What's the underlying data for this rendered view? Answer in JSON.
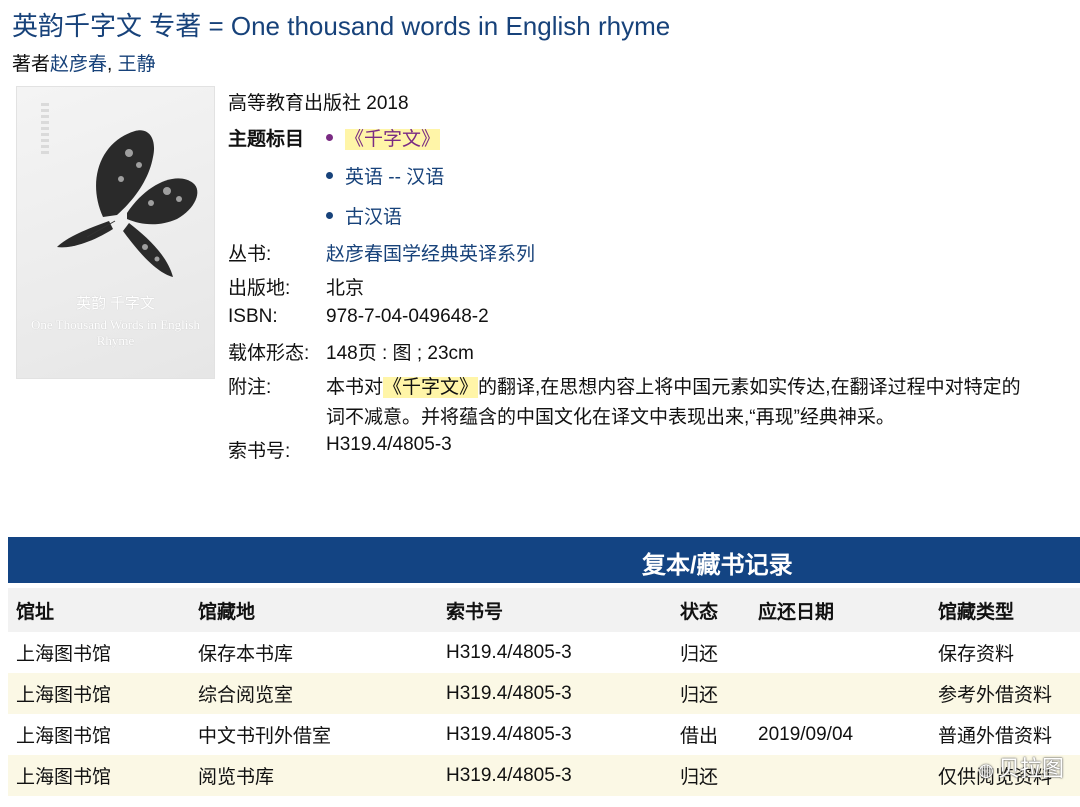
{
  "title": "英韵千字文 专著 = One thousand words in English rhyme",
  "authors_prefix": "著者",
  "authors": [
    "赵彦春",
    "王静"
  ],
  "authors_sep": ", ",
  "publisher_line": "高等教育出版社 2018",
  "subjects_label": "主题标目",
  "subjects": [
    "《千字文》",
    "英语 -- 汉语",
    "古汉语"
  ],
  "fields": [
    {
      "label": "丛书:",
      "value": "赵彦春国学经典英译系列"
    },
    {
      "label": "出版地:",
      "value": "北京"
    },
    {
      "label": "ISBN:",
      "value": "978-7-04-049648-2"
    },
    {
      "label": "载体形态:",
      "value": "148页 : 图 ; 23cm"
    }
  ],
  "note": {
    "label": "附注:",
    "line1_prefix": "本书对",
    "line1_highlight": "《千字文》",
    "line1_suffix": "的翻译,在思想内容上将中国元素如实传达,在翻译过程中对特定的",
    "line2": "词不减意。并将蕴含的中国文化在译文中表现出来,“再现”经典神采。"
  },
  "call_number": {
    "label": "索书号:",
    "value": "H319.4/4805-3"
  },
  "cover": {
    "title": "英韵 千字文",
    "subtitle": "One Thousand Words in English Rhyme"
  },
  "holdings": {
    "banner": "复本/藏书记录",
    "columns": [
      "馆址",
      "馆藏地",
      "索书号",
      "状态",
      "应还日期",
      "馆藏类型"
    ],
    "rows": [
      [
        "上海图书馆",
        "保存本书库",
        "H319.4/4805-3",
        "归还",
        "",
        "保存资料"
      ],
      [
        "上海图书馆",
        "综合阅览室",
        "H319.4/4805-3",
        "归还",
        "",
        "参考外借资料"
      ],
      [
        "上海图书馆",
        "中文书刊外借室",
        "H319.4/4805-3",
        "借出",
        "2019/09/04",
        "普通外借资料"
      ],
      [
        "上海图书馆",
        "阅览书库",
        "H319.4/4805-3",
        "归还",
        "",
        "仅供阅览资料"
      ]
    ]
  },
  "watermark": "贝拉图",
  "colors": {
    "link": "#17427a",
    "visited": "#7a2b83",
    "banner": "#134483",
    "highlight": "#fff5a8",
    "row_alt": "#fbf8e5"
  }
}
